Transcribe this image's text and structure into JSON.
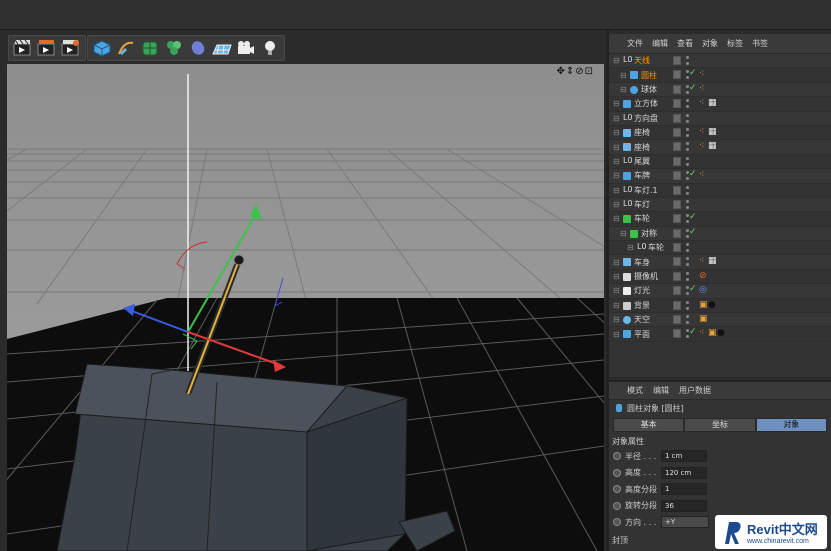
{
  "objects_menu": [
    "文件",
    "编辑",
    "查看",
    "对象",
    "标签",
    "书签"
  ],
  "objects": [
    {
      "name": "天线",
      "indent": 0,
      "icon": "null-icon",
      "selected": true,
      "check": false,
      "tags": []
    },
    {
      "name": "圆柱",
      "indent": 1,
      "icon": "cylinder-icon",
      "selected": true,
      "check": true,
      "tags": [
        "phong"
      ]
    },
    {
      "name": "球体",
      "indent": 1,
      "icon": "sphere-icon",
      "selected": false,
      "check": true,
      "tags": [
        "phong"
      ]
    },
    {
      "name": "立方体",
      "indent": 0,
      "icon": "cube-object-icon",
      "selected": false,
      "check": false,
      "tags": [
        "phong",
        "checker"
      ]
    },
    {
      "name": "方向盘",
      "indent": 0,
      "icon": "null-icon",
      "selected": false,
      "check": false,
      "tags": []
    },
    {
      "name": "座椅",
      "indent": 0,
      "icon": "poly-icon",
      "selected": false,
      "check": false,
      "tags": [
        "phong",
        "checker"
      ]
    },
    {
      "name": "座椅",
      "indent": 0,
      "icon": "poly-icon",
      "selected": false,
      "check": false,
      "tags": [
        "phong",
        "checker"
      ]
    },
    {
      "name": "尾翼",
      "indent": 0,
      "icon": "null-icon",
      "selected": false,
      "check": false,
      "tags": []
    },
    {
      "name": "车牌",
      "indent": 0,
      "icon": "cube-object-icon",
      "selected": false,
      "check": true,
      "tags": [
        "phong"
      ]
    },
    {
      "name": "车灯.1",
      "indent": 0,
      "icon": "null-icon",
      "selected": false,
      "check": false,
      "tags": []
    },
    {
      "name": "车灯",
      "indent": 0,
      "icon": "null-icon",
      "selected": false,
      "check": false,
      "tags": []
    },
    {
      "name": "车轮",
      "indent": 0,
      "icon": "symmetry-icon",
      "selected": false,
      "check": true,
      "tags": []
    },
    {
      "name": "对称",
      "indent": 1,
      "icon": "symmetry-icon",
      "selected": false,
      "check": true,
      "tags": []
    },
    {
      "name": "车轮",
      "indent": 2,
      "icon": "null-icon",
      "selected": false,
      "check": false,
      "tags": []
    },
    {
      "name": "车身",
      "indent": 0,
      "icon": "poly-icon",
      "selected": false,
      "check": false,
      "tags": [
        "phong",
        "checker"
      ]
    },
    {
      "name": "摄像机",
      "indent": 0,
      "icon": "camera-object-icon",
      "selected": false,
      "check": false,
      "tags": [
        "protect"
      ]
    },
    {
      "name": "灯光",
      "indent": 0,
      "icon": "light-object-icon",
      "selected": false,
      "check": true,
      "tags": [
        "target"
      ]
    },
    {
      "name": "背景",
      "indent": 0,
      "icon": "background-icon",
      "selected": false,
      "check": false,
      "tags": [
        "display",
        "material"
      ]
    },
    {
      "name": "天空",
      "indent": 0,
      "icon": "sky-icon",
      "selected": false,
      "check": false,
      "tags": [
        "display"
      ]
    },
    {
      "name": "平面",
      "indent": 0,
      "icon": "plane-icon",
      "selected": false,
      "check": true,
      "tags": [
        "phong",
        "display",
        "material"
      ]
    }
  ],
  "attributes": {
    "menu": [
      "模式",
      "编辑",
      "用户数据"
    ],
    "title": "圆柱对象 [圆柱]",
    "tabs": [
      "基本",
      "坐标",
      "对象"
    ],
    "active_tab": 2,
    "section": "对象属性",
    "props": [
      {
        "label": "半径 . . .",
        "value": "1 cm"
      },
      {
        "label": "高度 . . .",
        "value": "120 cm"
      },
      {
        "label": "高度分段",
        "value": "1"
      },
      {
        "label": "旋转分段",
        "value": "36"
      },
      {
        "label": "方向 . . .",
        "value": "+Y"
      }
    ],
    "section2": "封顶"
  },
  "logo": {
    "brand": "Revit中文网",
    "url": "www.chinarevit.com"
  },
  "colors": {
    "selected": "#ff9a00",
    "check": "#67d36a",
    "active_tab": "#6f8fbf"
  }
}
